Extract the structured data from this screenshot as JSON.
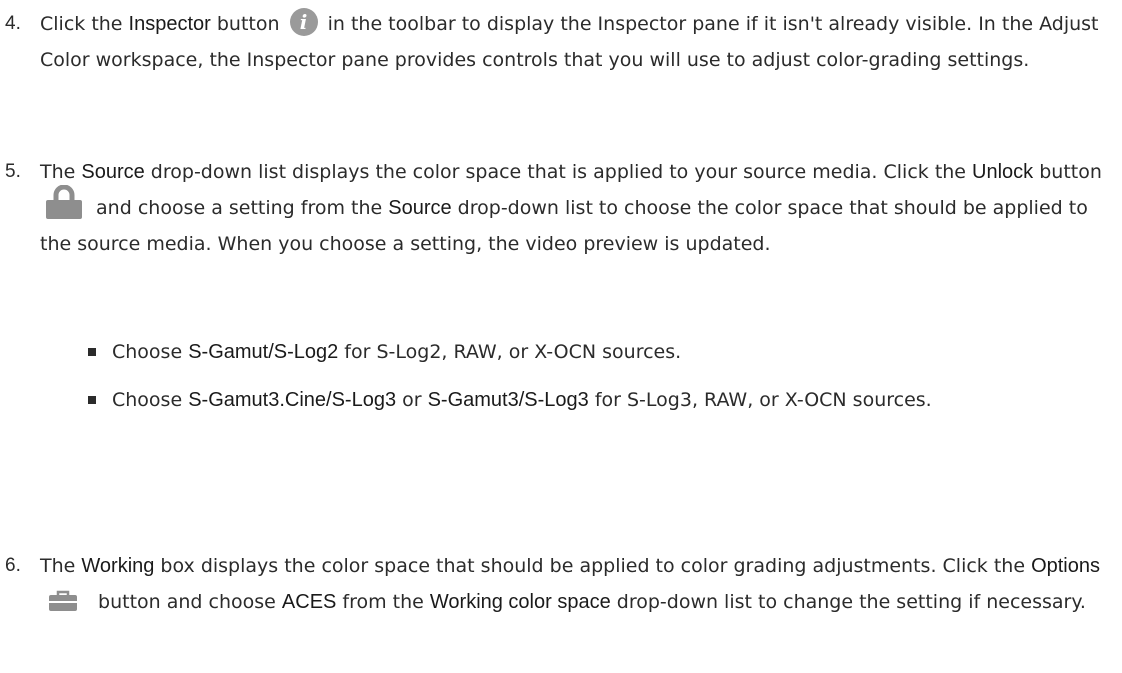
{
  "icons": {
    "inspector": "info-icon",
    "unlock": "lock-icon",
    "options": "briefcase-icon"
  },
  "steps": {
    "s4": {
      "num": "4.",
      "t1": "Click the ",
      "b1": "Inspector",
      "t2": " button ",
      "t3": " in the toolbar to display the Inspector pane if it isn't already visible. In the Adjust Color workspace, the Inspector pane provides controls that you will use to adjust color-grading settings."
    },
    "s5": {
      "num": "5.",
      "t1": "The ",
      "b1": "Source",
      "t2": " drop-down list displays the color space that is applied to your source media. Click the ",
      "b2": "Unlock",
      "t3": " button ",
      "t4": " and choose a setting from the ",
      "b3": "Source",
      "t5": " drop-down list to choose the color space that should be applied to the source media. When you choose a setting, the video preview is updated.",
      "bullet1": {
        "t1": "Choose ",
        "b1": "S-Gamut/S-Log2",
        "t2": " for S-Log2, RAW, or X-OCN sources."
      },
      "bullet2": {
        "t1": "Choose ",
        "b1": "S-Gamut3.Cine/S-Log3",
        "t2": " or ",
        "b2": "S-Gamut3/S-Log3",
        "t3": " for S-Log3, RAW, or X-OCN sources."
      }
    },
    "s6": {
      "num": "6.",
      "t1": "The ",
      "b1": "Working",
      "t2": "  box displays the color space that should be applied to color grading adjustments. Click the ",
      "b2": "Options",
      "t3": " button and choose ",
      "b3": "ACES",
      "t4": " from the ",
      "b4": "Working color space",
      "t5": " drop-down list to change the setting if necessary."
    }
  }
}
